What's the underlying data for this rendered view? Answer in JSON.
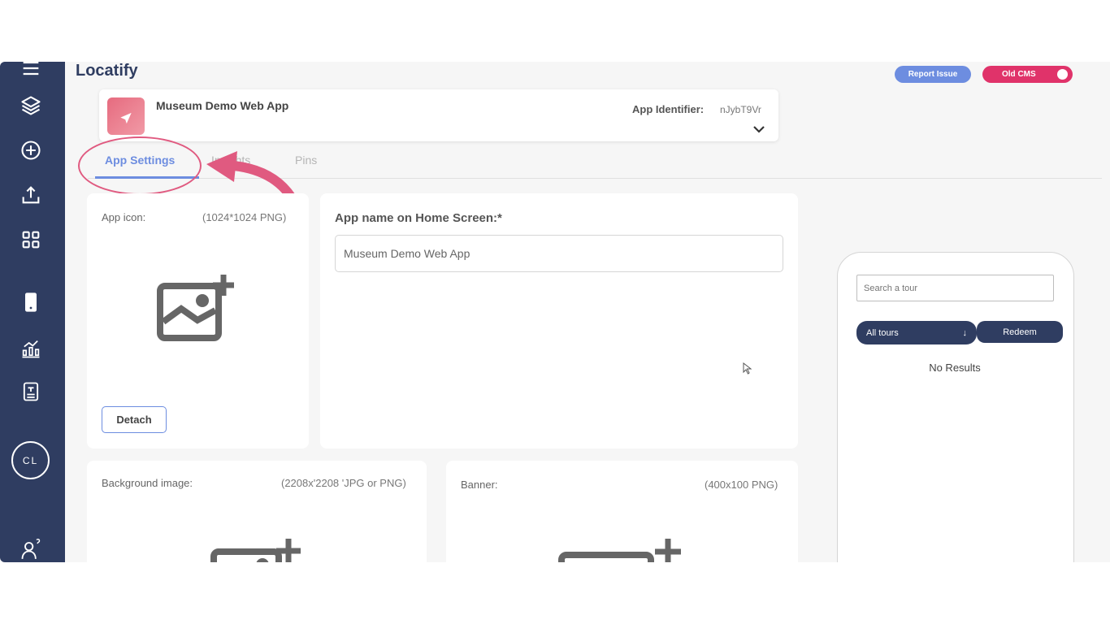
{
  "header": {
    "logo": "Locatify",
    "report_issue": "Report Issue",
    "old_cms": "Old CMS"
  },
  "app": {
    "name": "Museum Demo Web App",
    "identifier_label": "App Identifier:",
    "identifier_value": "nJybT9Vr"
  },
  "tabs": [
    {
      "label": "App Settings",
      "active": true
    },
    {
      "label": "Insights",
      "active": false
    },
    {
      "label": "Pins",
      "active": false
    }
  ],
  "icon_card": {
    "label": "App icon:",
    "hint": "(1024*1024 PNG)",
    "detach": "Detach"
  },
  "name_card": {
    "title": "App name on Home Screen:*",
    "value": "Museum Demo Web App"
  },
  "background_card": {
    "label": "Background image:",
    "hint": "(2208x'2208 'JPG or PNG)"
  },
  "banner_card": {
    "label": "Banner:",
    "hint": "(400x100 PNG)"
  },
  "preview": {
    "search_placeholder": "Search a tour",
    "all_tours": "All tours",
    "redeem": "Redeem",
    "no_results": "No Results"
  },
  "user": {
    "initials": "CL"
  },
  "colors": {
    "sidebar": "#2f3d61",
    "accent": "#6d8de0",
    "annotation": "#e05a80",
    "old_cms": "#e0336a"
  },
  "icons": {
    "sidebar": [
      "menu-icon",
      "layers-icon",
      "add-circle-icon",
      "upload-icon",
      "apps-grid-icon",
      "mobile-icon",
      "analytics-icon",
      "survey-icon",
      "help-user-icon"
    ]
  }
}
